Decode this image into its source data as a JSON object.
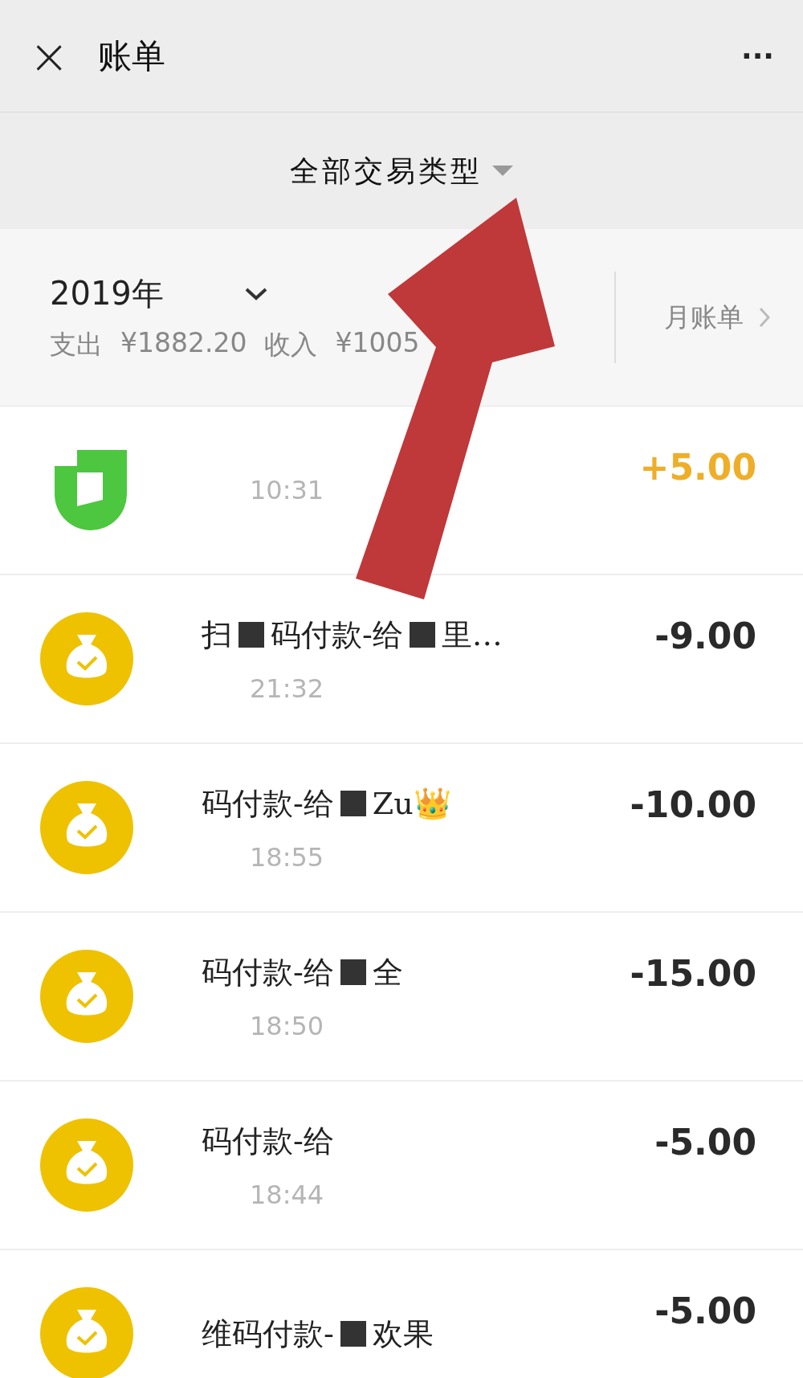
{
  "header": {
    "close": "×",
    "title": "账单",
    "more": "···"
  },
  "filter": {
    "label": "全部交易类型"
  },
  "summary": {
    "year": "2019年",
    "expense_label": "支出",
    "expense": "¥1882.20",
    "income_label": "收入",
    "income": "¥1005",
    "monthly": "月账单"
  },
  "transactions": [
    {
      "kind": "app",
      "time": "10:31",
      "amount": "+5.00",
      "income": true
    },
    {
      "kind": "wallet",
      "title_parts": [
        "扫",
        "码付款-给",
        "里…"
      ],
      "time": "21:32",
      "amount": "-9.00",
      "income": false
    },
    {
      "kind": "wallet",
      "title_parts": [
        "码付款-给",
        "Zu👑"
      ],
      "time": "18:55",
      "amount": "-10.00",
      "income": false
    },
    {
      "kind": "wallet",
      "title_parts": [
        "码付款-给",
        "全"
      ],
      "time": "18:50",
      "amount": "-15.00",
      "income": false
    },
    {
      "kind": "wallet",
      "title_parts": [
        "码付款-给"
      ],
      "time": "18:44",
      "amount": "-5.00",
      "income": false
    },
    {
      "kind": "wallet",
      "title_parts": [
        "维码付款-",
        "欢果"
      ],
      "amount": "-5.00",
      "income": false
    }
  ],
  "annotation": {
    "kind": "arrow"
  }
}
